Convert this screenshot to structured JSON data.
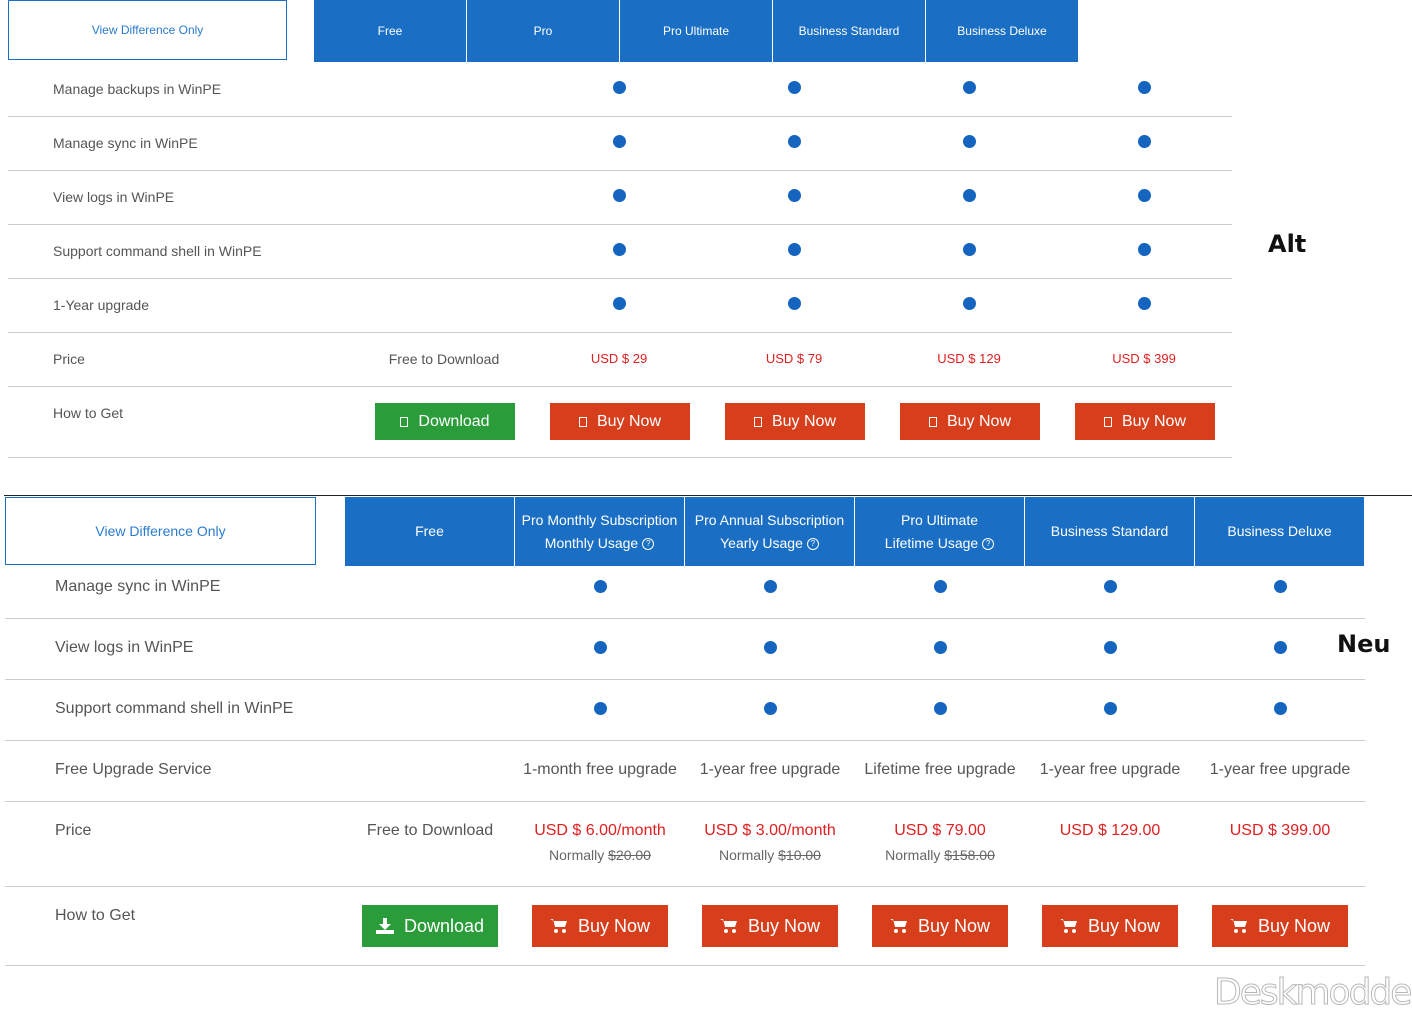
{
  "old": {
    "view_difference_label": "View Difference Only",
    "columns": [
      "Free",
      "Pro",
      "Pro Ultimate",
      "Business Standard",
      "Business Deluxe"
    ],
    "rows": [
      "Manage backups in WinPE",
      "Manage sync in WinPE",
      "View logs in WinPE",
      "Support command shell in WinPE",
      "1-Year upgrade"
    ],
    "price_label": "Price",
    "prices": [
      "Free to Download",
      "USD $ 29",
      "USD $ 79",
      "USD $ 129",
      "USD $ 399"
    ],
    "how_to_get_label": "How to Get",
    "download_label": "Download",
    "buy_label": "Buy Now",
    "tag": "Alt"
  },
  "new": {
    "view_difference_label": "View Difference Only",
    "columns": [
      {
        "line1": "Free",
        "line2": ""
      },
      {
        "line1": "Pro Monthly Subscription",
        "line2": "Monthly Usage"
      },
      {
        "line1": "Pro Annual Subscription",
        "line2": "Yearly Usage"
      },
      {
        "line1": "Pro Ultimate",
        "line2": "Lifetime Usage"
      },
      {
        "line1": "Business Standard",
        "line2": ""
      },
      {
        "line1": "Business Deluxe",
        "line2": ""
      }
    ],
    "rows": [
      "Manage sync in WinPE",
      "View logs in WinPE",
      "Support command shell in WinPE"
    ],
    "upgrade_label": "Free Upgrade Service",
    "upgrades": [
      "1-month free upgrade",
      "1-year free upgrade",
      "Lifetime free upgrade",
      "1-year free upgrade",
      "1-year free upgrade"
    ],
    "price_label": "Price",
    "free_price": "Free to Download",
    "prices": [
      "USD $ 6.00/month",
      "USD $ 3.00/month",
      "USD $ 79.00",
      "USD $ 129.00",
      "USD $ 399.00"
    ],
    "normally_label": "Normally",
    "normal_prices": [
      "$20.00",
      "$10.00",
      "$158.00"
    ],
    "how_to_get_label": "How to Get",
    "download_label": "Download",
    "buy_label": "Buy Now",
    "tag": "Neu"
  },
  "watermark": "Deskmodder.de",
  "colors": {
    "header_blue": "#1a6fc4",
    "dot_blue": "#1565c0",
    "price_red": "#e02020",
    "download_green": "#2a9d3a",
    "buy_red": "#d63e1c"
  }
}
